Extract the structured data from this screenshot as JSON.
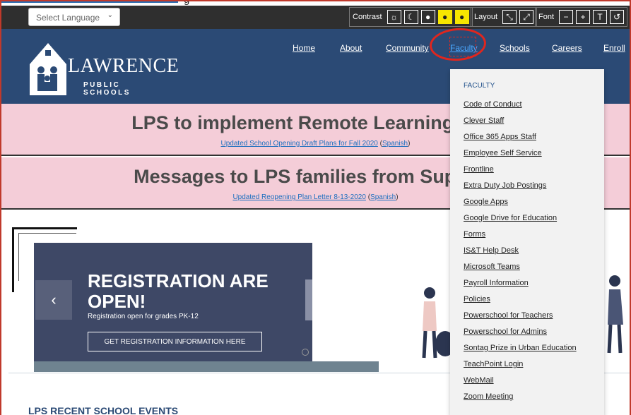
{
  "top_cut_text": "g",
  "toolbar": {
    "language_placeholder": "Select Language",
    "contrast_label": "Contrast",
    "layout_label": "Layout",
    "font_label": "Font"
  },
  "logo": {
    "name": "LAWRENCE",
    "sub": "PUBLIC SCHOOLS"
  },
  "nav": [
    "Home",
    "About",
    "Community",
    "Faculty",
    "Schools",
    "Careers",
    "Enroll"
  ],
  "banners": [
    {
      "title": "LPS to implement Remote Learning Plan",
      "link1": "Updated School Opening Draft Plans for Fall 2020",
      "link2": "Spanish"
    },
    {
      "title": "Messages to LPS families from Superint",
      "link1": "Updated Reopening Plan Letter 8-13-2020",
      "link2": "Spanish"
    }
  ],
  "slide": {
    "heading": "REGISTRATION ARE OPEN!",
    "text": "Registration open for grades PK-12",
    "button": "GET REGISTRATION INFORMATION HERE",
    "prev": "‹"
  },
  "section_heading": "LPS RECENT SCHOOL EVENTS",
  "faculty_menu": {
    "heading": "FACULTY",
    "items": [
      "Code of Conduct",
      "Clever Staff",
      "Office 365 Apps Staff",
      "Employee Self Service",
      "Frontline",
      "Extra Duty Job Postings",
      "Google Apps",
      "Google Drive for Education",
      "Forms",
      "IS&T Help Desk",
      "Microsoft Teams",
      "Payroll Information",
      "Policies",
      "Powerschool for Teachers",
      "Powerschool for Admins",
      "Sontag Prize in Urban Education",
      "TeachPoint Login",
      "WebMail",
      "Zoom Meeting"
    ]
  },
  "colors": {
    "navbar": "#2b4a75",
    "banner": "#f4cdd8",
    "annotation": "#e0261e",
    "accent_yellow": "#f7e600"
  }
}
